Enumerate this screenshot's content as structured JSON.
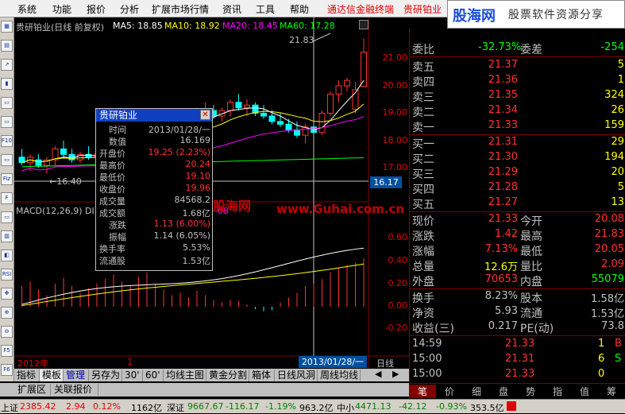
{
  "menu": {
    "items": [
      "系统",
      "功能",
      "报价",
      "分析",
      "扩展市场行情",
      "资讯",
      "工具",
      "帮助"
    ],
    "red_items": [
      "通达信金融终端",
      "贵研铂业"
    ]
  },
  "logo": {
    "main": "股海网",
    "sub": "股票软件资源分享",
    "url_pre": "www.",
    "url_accent": "Guhai",
    "url_post": ".com.cn"
  },
  "left_toolbar": [
    "grid-icon",
    "bar-chart-icon",
    "line-chart-icon",
    "candle-icon",
    "text-icon",
    "text-icon",
    "f10-icon",
    "text-icon",
    "fiz-icon",
    "f-icon",
    "text-icon",
    "bars-icon",
    "chart-icon",
    "rsi-icon",
    "move-icon",
    "plus-icon",
    "zoom-icon",
    "f5-icon",
    "f6-icon"
  ],
  "left_toolbar_labels": [
    "▦",
    "▤",
    "↗",
    "▮",
    "▭",
    "▭",
    "F10",
    "▭",
    "Fiz",
    "F",
    "▭",
    "▥",
    "◧",
    "RSI",
    "✥",
    "⊕",
    "⊖",
    "F5",
    "F6"
  ],
  "chart": {
    "title": "贵研铂业(日线 前复权)",
    "ma5_label": "MA5: 18.85",
    "ma10_label": "MA10: 18.92",
    "ma20_label": "MA20: 18.45",
    "ma60_label": "MA60: 17.28",
    "high_annotation": "21.83",
    "low_annotation": "16.40",
    "price_axis": [
      "21.00",
      "20.00",
      "19.00",
      "18.00",
      "17.00"
    ],
    "cursor_price": "16.17",
    "macd_label": "MACD(12,26,9) DI",
    "macd_value_partial": "08",
    "macd_axis": [
      "0.60",
      "0.40",
      "0.20",
      "0.00",
      "-0.20"
    ],
    "x_year_label": "2012年",
    "x_tick": "1",
    "x_cursor_date": "2013/01/28/一",
    "x_period": "日线",
    "colors": {
      "up": "#ff3232",
      "down": "#00ffff",
      "ma5": "#ffffff",
      "ma10": "#ffff00",
      "ma20": "#ff00ff",
      "ma60": "#00ff00"
    },
    "watermark_main": "股海网",
    "watermark_url": "www.Guhai.com.cn"
  },
  "popup": {
    "title": "贵研铂业",
    "rows": [
      {
        "label": "时间",
        "value": "2013/01/28/一",
        "color": "#c0c0c0"
      },
      {
        "label": "数值",
        "value": "16.169",
        "color": "#c0c0c0"
      },
      {
        "label": "开盘价",
        "value": "19.25 (2.23%)",
        "color": "#ff3232"
      },
      {
        "label": "最高价",
        "value": "20.24",
        "color": "#ff3232"
      },
      {
        "label": "最低价",
        "value": "19.10",
        "color": "#ff3232"
      },
      {
        "label": "收盘价",
        "value": "19.96",
        "color": "#ff3232"
      },
      {
        "label": "成交量",
        "value": "84568.2",
        "color": "#c0c0c0"
      },
      {
        "label": "成交额",
        "value": "1.68亿",
        "color": "#c0c0c0"
      },
      {
        "label": "涨跌",
        "value": "1.13 (6.00%)",
        "color": "#ff3232"
      },
      {
        "label": "振幅",
        "value": "1.14 (6.05%)",
        "color": "#c0c0c0"
      },
      {
        "label": "换手率",
        "value": "5.53%",
        "color": "#c0c0c0"
      },
      {
        "label": "流通股",
        "value": "1.53亿",
        "color": "#c0c0c0"
      }
    ]
  },
  "quote": {
    "weibi_label": "委比",
    "weibi_value": "-32.73%",
    "weicha_label": "委差",
    "weicha_value": "-254",
    "sell": [
      {
        "label": "卖五",
        "price": "21.37",
        "vol": "5"
      },
      {
        "label": "卖四",
        "price": "21.36",
        "vol": "1"
      },
      {
        "label": "卖三",
        "price": "21.35",
        "vol": "324"
      },
      {
        "label": "卖二",
        "price": "21.34",
        "vol": "26"
      },
      {
        "label": "卖一",
        "price": "21.33",
        "vol": "159"
      }
    ],
    "buy": [
      {
        "label": "买一",
        "price": "21.31",
        "vol": "29"
      },
      {
        "label": "买二",
        "price": "21.30",
        "vol": "194"
      },
      {
        "label": "买三",
        "price": "21.29",
        "vol": "20"
      },
      {
        "label": "买四",
        "price": "21.28",
        "vol": "5"
      },
      {
        "label": "买五",
        "price": "21.27",
        "vol": "13"
      }
    ],
    "stats": [
      {
        "l1": "现价",
        "v1": "21.33",
        "c1": "#ff3232",
        "l2": "今开",
        "v2": "20.08",
        "c2": "#ff3232"
      },
      {
        "l1": "涨跌",
        "v1": "1.42",
        "c1": "#ff3232",
        "l2": "最高",
        "v2": "21.83",
        "c2": "#ff3232"
      },
      {
        "l1": "涨幅",
        "v1": "7.13%",
        "c1": "#ff3232",
        "l2": "最低",
        "v2": "20.05",
        "c2": "#ff3232"
      },
      {
        "l1": "总量",
        "v1": "12.6万",
        "c1": "#ffff00",
        "l2": "量比",
        "v2": "2.09",
        "c2": "#ff3232"
      },
      {
        "l1": "外盘",
        "v1": "70653",
        "c1": "#ff3232",
        "l2": "内盘",
        "v2": "55079",
        "c2": "#00ff00"
      }
    ],
    "fund": [
      {
        "l1": "换手",
        "v1": "8.23%",
        "l2": "股本",
        "v2": "1.58亿"
      },
      {
        "l1": "净资",
        "v1": "5.93",
        "l2": "流通",
        "v2": "1.53亿"
      },
      {
        "l1": "收益(三)",
        "v1": "0.217",
        "l2": "PE(动)",
        "v2": "73.8"
      }
    ],
    "ticks": [
      {
        "time": "14:59",
        "price": "21.33",
        "vol": "1",
        "flag": "B",
        "vcolor": "#ffff00",
        "fcolor": "#ff3232"
      },
      {
        "time": "15:00",
        "price": "21.31",
        "vol": "6",
        "flag": "S",
        "vcolor": "#ffff00",
        "fcolor": "#00ff00"
      },
      {
        "time": "15:00",
        "price": "21.33",
        "vol": "0",
        "flag": "",
        "vcolor": "#ffff00",
        "fcolor": "#ff3232"
      }
    ]
  },
  "tabs": [
    "指标",
    "模板",
    "管理",
    "另存为",
    "30'",
    "60'",
    "均线主图",
    "黄金分割",
    "箱体",
    "日线风洞",
    "周线均线"
  ],
  "tabs2": [
    "扩展区",
    "关联报价"
  ],
  "right_tabs": [
    "笔",
    "价",
    "细",
    "盘",
    "势",
    "指",
    "值",
    "筹"
  ],
  "status": {
    "sh_label": "上证",
    "sh_value": "2385.42",
    "sh_change": "2.94",
    "sh_pct": "0.12%",
    "sh_amount": "1162亿",
    "sz_label": "深证",
    "sz_value": "9667.67",
    "sz_change": "-116.17",
    "sz_pct": "-1.19%",
    "sz_amount": "963.2亿",
    "zx_label": "中小",
    "zx_value": "4471.13",
    "zx_change": "-42.12",
    "zx_pct": "-0.93%",
    "zx_amount": "353.5亿"
  }
}
